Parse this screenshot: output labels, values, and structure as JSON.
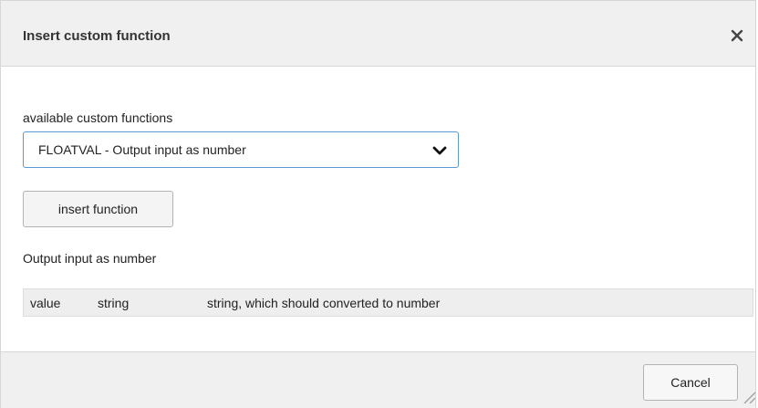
{
  "dialog": {
    "title": "Insert custom function",
    "close_icon": "close-icon"
  },
  "functions": {
    "label": "available custom functions",
    "selected": "FLOATVAL - Output input as number",
    "dropdown_icon": "chevron-down-icon"
  },
  "insert_button": "insert function",
  "function_description": "Output input as number",
  "parameters": [
    {
      "name": "value",
      "type": "string",
      "description": "string, which should converted to number"
    }
  ],
  "footer": {
    "cancel_label": "Cancel",
    "resize_icon": "resize-grip-icon"
  },
  "colors": {
    "select_border": "#5b9bd5",
    "header_bg": "#f0f0f0",
    "param_row_bg": "#eeeeee"
  }
}
